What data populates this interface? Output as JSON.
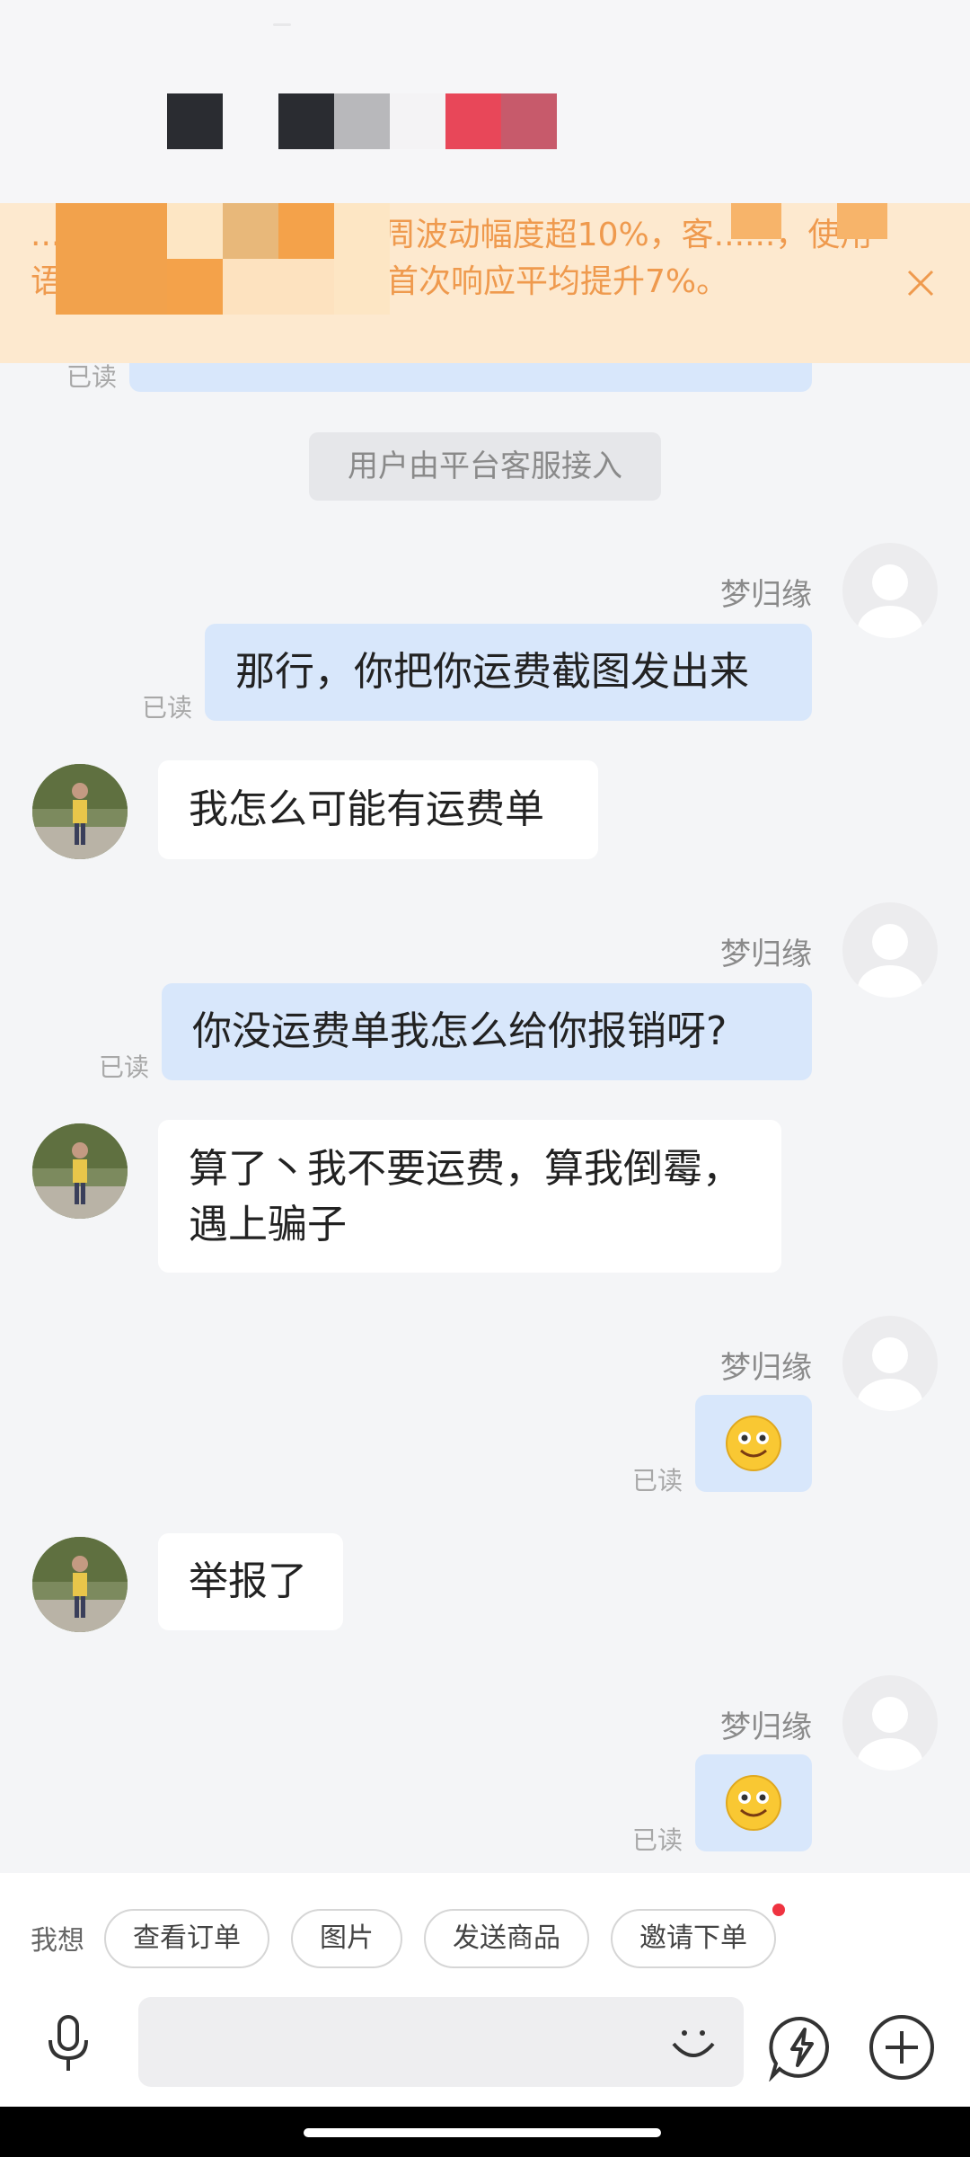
{
  "notice": {
    "text": "......的三分钟回复率较上周波动幅度超10%，客......，使用语音转文字和快捷短语，首次响应平均提升7%。",
    "close_icon": "close-icon"
  },
  "chat": {
    "top_read": "已读",
    "system_message": "用户由平台客服接入",
    "messages": [
      {
        "sender": "梦归缘",
        "text": "那行，你把你运费截图发出来",
        "status": "已读"
      },
      {
        "text": "我怎么可能有运费单"
      },
      {
        "sender": "梦归缘",
        "text": "你没运费单我怎么给你报销呀?",
        "status": "已读"
      },
      {
        "text": "算了丶我不要运费，算我倒霉，遇上骗子"
      },
      {
        "sender": "梦归缘",
        "emoji": "smiley-emoji",
        "status": "已读"
      },
      {
        "text": "举报了"
      },
      {
        "sender": "梦归缘",
        "emoji": "smiley-emoji",
        "status": "已读"
      }
    ]
  },
  "quick_actions": {
    "label": "我想",
    "chips": [
      "查看订单",
      "图片",
      "发送商品",
      "邀请下单"
    ]
  },
  "input": {
    "placeholder": "",
    "icons": [
      "microphone-icon",
      "smile-icon",
      "lightning-chat-icon",
      "plus-icon"
    ]
  },
  "colors": {
    "my_bubble": "#d8e7fb",
    "their_bubble": "#ffffff",
    "notice_bg": "#fde9cf",
    "notice_text": "#ef9a4e",
    "badge_red": "#ef3340"
  }
}
